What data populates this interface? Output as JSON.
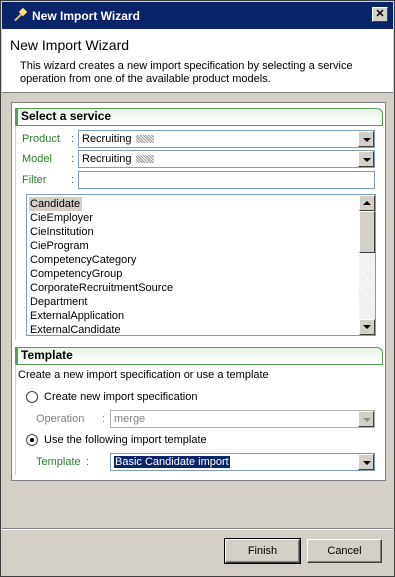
{
  "window": {
    "title": "New Import Wizard",
    "close_glyph": "✕"
  },
  "header": {
    "title": "New Import Wizard",
    "description": "This wizard creates a new import specification by selecting a service operation from one of the available product models."
  },
  "service_section": {
    "title": "Select a service",
    "product_label": "Product",
    "product_value": "Recruiting",
    "model_label": "Model",
    "model_value": "Recruiting",
    "filter_label": "Filter",
    "filter_value": "",
    "colon": ":",
    "service_items": [
      "Candidate",
      "CieEmployer",
      "CieInstitution",
      "CieProgram",
      "CompetencyCategory",
      "CompetencyGroup",
      "CorporateRecruitmentSource",
      "Department",
      "ExternalApplication",
      "ExternalCandidate"
    ],
    "selected_item": "Candidate"
  },
  "template_section": {
    "title": "Template",
    "instruction": "Create a new import specification or use a template",
    "option_new": "Create new import specification",
    "operation_label": "Operation",
    "operation_value": "merge",
    "option_template": "Use the following import template",
    "template_label": "Template",
    "template_value": "Basic Candidate import",
    "selected_option": "template"
  },
  "buttons": {
    "finish": "Finish",
    "cancel": "Cancel"
  },
  "colors": {
    "titlebar": "#0a246a",
    "section_accent": "#5a9a5a",
    "label_green": "#2e7d2e"
  },
  "icons": {
    "app": "wizard-wand-icon",
    "close": "close-icon",
    "dropdown": "chevron-down-icon"
  }
}
